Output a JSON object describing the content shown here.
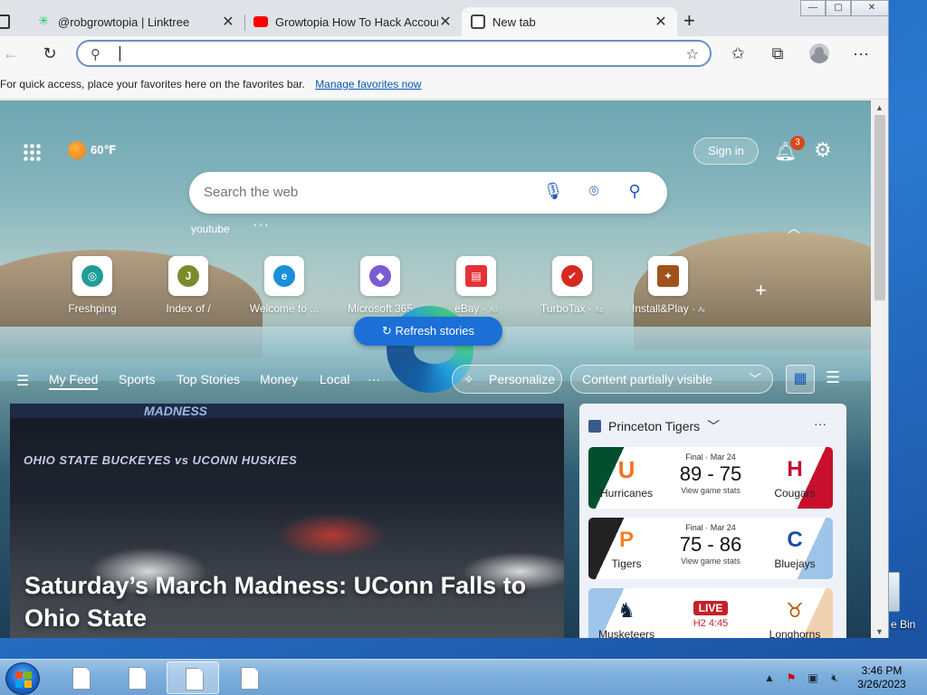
{
  "tabs": [
    {
      "title": "@robgrowtopia | Linktree",
      "favicon_color": "#2ecc71",
      "close": "✕"
    },
    {
      "title": "Growtopia How To Hack Account",
      "favicon_color": "#ff0000",
      "close": "✕"
    },
    {
      "title": "New tab",
      "favicon_color": "#444444",
      "close": "✕"
    }
  ],
  "new_tab_plus": "+",
  "window_controls": {
    "minimize": "—",
    "maximize": "▢",
    "close": "✕"
  },
  "address_bar": {
    "value": "",
    "placeholder": ""
  },
  "favorites_bar": {
    "message": "For quick access, place your favorites here on the favorites bar.",
    "link": "Manage favorites now"
  },
  "ntp": {
    "weather": "60℉",
    "sign_in": "Sign in",
    "notification_count": "3",
    "search_placeholder": "Search the web",
    "recent_search": "youtube",
    "more": "···",
    "quick_links": [
      {
        "label": "Freshping",
        "ad": "",
        "icon_color": "#1f9e95",
        "icon_text": "◎"
      },
      {
        "label": "Index of /",
        "ad": "",
        "icon_color": "#7b8a2a",
        "icon_text": "J"
      },
      {
        "label": "Welcome to ...",
        "ad": "",
        "icon_color": "#1a8fd8",
        "icon_text": "e"
      },
      {
        "label": "Microsoft 365",
        "ad": "",
        "icon_color": "#7a5bd1",
        "icon_text": "◆"
      },
      {
        "label": "eBay",
        "ad": "Ad",
        "icon_color": "#e53238",
        "icon_text": "▤"
      },
      {
        "label": "TurboTax",
        "ad": "Ad",
        "icon_color": "#d52b1e",
        "icon_text": "✔"
      },
      {
        "label": "Install&Play",
        "ad": "Ad",
        "icon_color": "#a0521d",
        "icon_text": "✦"
      }
    ],
    "feed_tabs": [
      "My Feed",
      "Sports",
      "Top Stories",
      "Money",
      "Local"
    ],
    "feed_more": "···",
    "personalize": "Personalize",
    "content_visibility": "Content partially visible",
    "refresh": "Refresh stories",
    "hero": {
      "banner": "MADNESS",
      "teams": "OHIO STATE BUCKEYES  vs  UCONN HUSKIES",
      "title": "Saturday’s March Madness: UConn Falls to Ohio State"
    },
    "sports": {
      "team": "Princeton Tigers",
      "more": "···",
      "games": [
        {
          "home": "Hurricanes",
          "away": "Cougars",
          "status": "Final · Mar 24",
          "score": "89 - 75",
          "stats": "View game stats",
          "home_color": "#005030",
          "away_color": "#c8102e",
          "live": "",
          "time": ""
        },
        {
          "home": "Tigers",
          "away": "Bluejays",
          "status": "Final · Mar 24",
          "score": "75 - 86",
          "stats": "View game stats",
          "home_color": "#222222",
          "away_color": "#1b4f9c",
          "live": "",
          "time": ""
        },
        {
          "home": "Musketeers",
          "away": "Longhorns",
          "status": "",
          "score": "",
          "stats": "",
          "home_color": "#0c2340",
          "away_color": "#bf5700",
          "live": "LIVE",
          "time": "H2 4:45"
        }
      ]
    }
  },
  "taskbar": {
    "time": "3:46 PM",
    "date": "3/26/2023",
    "desktop_icon_label": "e Bin"
  }
}
